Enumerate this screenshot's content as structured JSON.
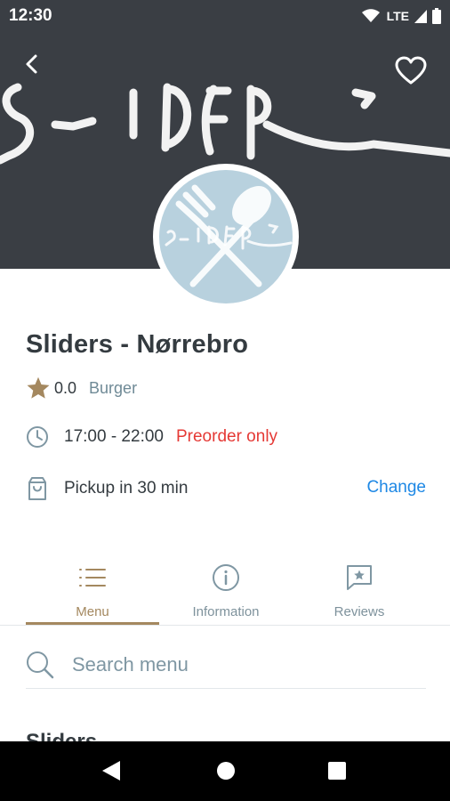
{
  "status_bar": {
    "time": "12:30",
    "network": "LTE",
    "icons": [
      "wifi-icon",
      "cellular-signal-icon",
      "battery-icon"
    ]
  },
  "header": {
    "back_icon": "chevron-left-icon",
    "favorite_icon": "heart-outline-icon",
    "logo_icon": "fork-spoon-icon"
  },
  "restaurant": {
    "name": "Sliders - Nørrebro",
    "rating": "0.0",
    "cuisine": "Burger",
    "hours": "17:00 - 22:00",
    "preorder": "Preorder only",
    "pickup": "Pickup in 30 min",
    "change": "Change"
  },
  "tabs": [
    {
      "label": "Menu",
      "icon": "list-icon",
      "active": true
    },
    {
      "label": "Information",
      "icon": "info-icon",
      "active": false
    },
    {
      "label": "Reviews",
      "icon": "review-star-icon",
      "active": false
    }
  ],
  "search": {
    "placeholder": "Search menu"
  },
  "menu": {
    "section_title": "Sliders"
  },
  "colors": {
    "accent": "#a4885f",
    "link": "#1e88e5",
    "warning": "#e53935",
    "hero_bg": "#3a3e44",
    "logo_bg": "#b8d1de",
    "star": "#a4885f"
  }
}
